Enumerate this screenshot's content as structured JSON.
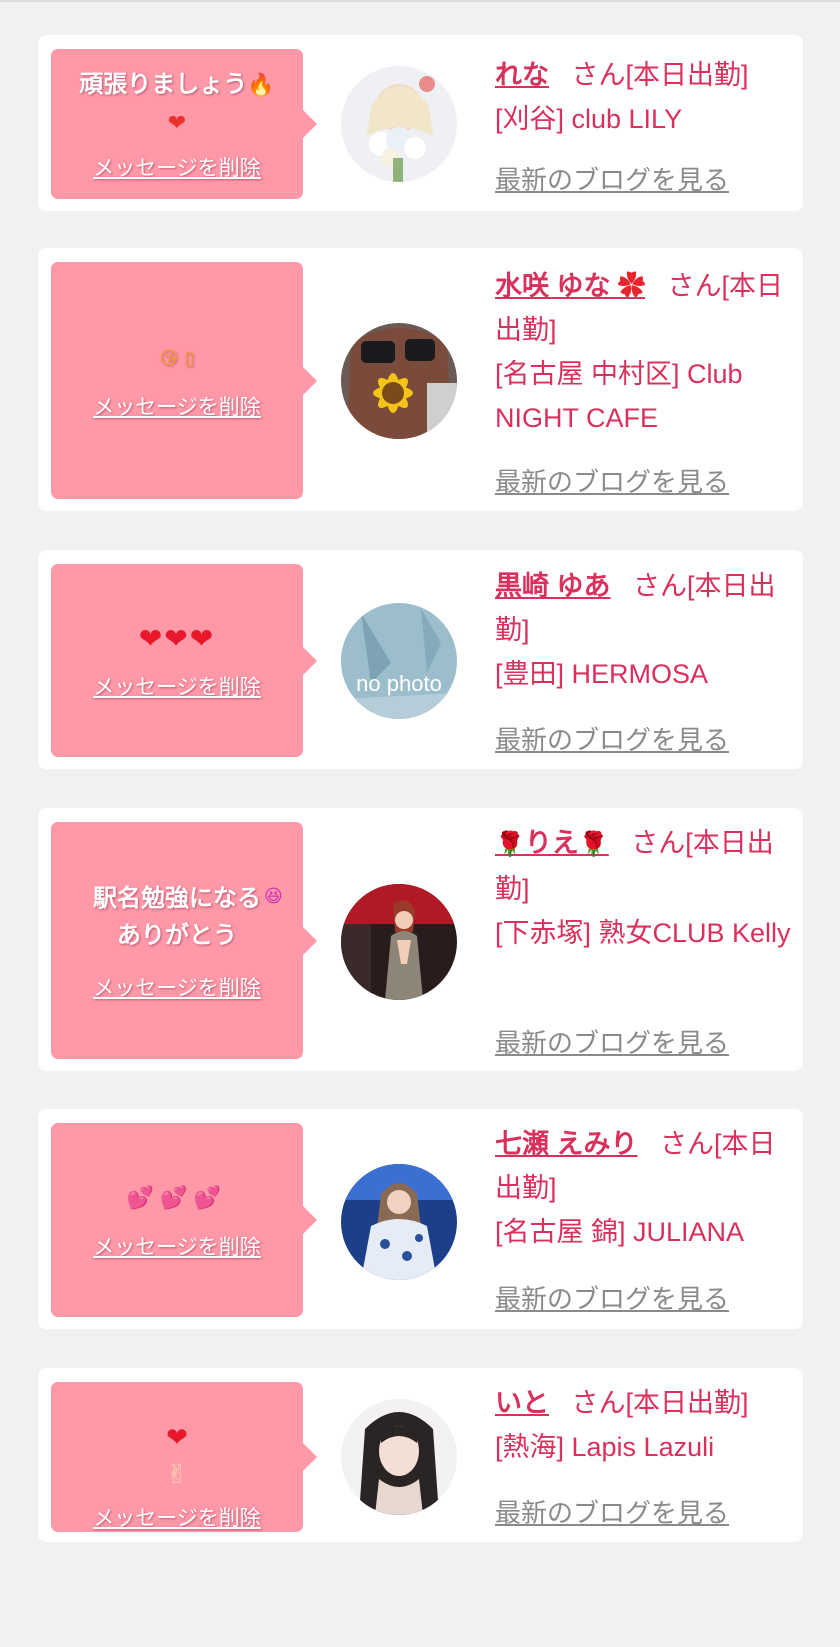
{
  "common": {
    "delete_label": "メッセージを削除",
    "blog_label": "最新のブログを見る",
    "name_suffix": "さん[本日出勤]",
    "accent_color": "#d9305c",
    "bubble_color": "#ff99a8"
  },
  "cards": [
    {
      "message": "頑張りましょう",
      "message_emoji": "🔥\n❤️‍🔥",
      "name": "れな",
      "shop": "[刈谷] club LILY",
      "avatar": "photo"
    },
    {
      "message": "",
      "message_emoji": "😘 ▯",
      "name": "水咲 ゆな",
      "name_emoji": "✿",
      "shop": "[名古屋 中村区] Club NIGHT CAFE",
      "avatar": "photo"
    },
    {
      "message": "",
      "message_emoji": "❤❤❤",
      "name": "黒崎 ゆあ",
      "shop": "[豊田] HERMOSA",
      "avatar": "no photo",
      "avatar_text": "no photo"
    },
    {
      "message": "駅名勉強になる\nありがとう",
      "message_emoji": "😆",
      "name": "りえ",
      "name_emoji_left": "🌹",
      "name_emoji_right": "🌹",
      "shop": "[下赤塚] 熟女CLUB Kelly",
      "avatar": "photo"
    },
    {
      "message": "",
      "message_emoji": "💕💕💕",
      "name": "七瀬 えみり",
      "shop": "[名古屋 錦] JULIANA",
      "avatar": "photo"
    },
    {
      "message": "",
      "message_emoji": "❤ ✌",
      "name": "いと",
      "shop": "[熱海] Lapis Lazuli",
      "avatar": "photo"
    }
  ]
}
